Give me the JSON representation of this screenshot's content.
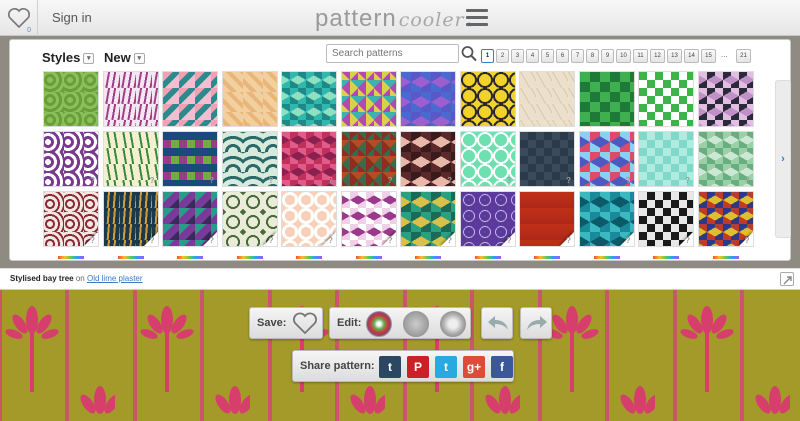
{
  "header": {
    "favorites_count": "0",
    "signin_label": "Sign in",
    "logo_text_a": "pattern",
    "logo_text_b": "cooler",
    "logo_star": "*"
  },
  "browser": {
    "styles_label": "Styles",
    "new_label": "New",
    "dropdown_glyph": "▾",
    "search_placeholder": "Search patterns",
    "pages": [
      "1",
      "2",
      "3",
      "4",
      "5",
      "6",
      "7",
      "8",
      "9",
      "10",
      "11",
      "12",
      "13",
      "14",
      "15"
    ],
    "active_page": "1",
    "pages_ellipsis": "...",
    "last_page": "21",
    "next_arrow": "›",
    "tile_unknown_mark": "?"
  },
  "selection": {
    "pattern_name": "Stylised bay tree",
    "on_label": "on",
    "background_name": "Old lime plaster"
  },
  "controls": {
    "save_label": "Save:",
    "edit_label": "Edit:",
    "share_label": "Share pattern:",
    "share_buttons": [
      {
        "label": "t",
        "color": "#2c4762",
        "icon": "tumblr-icon"
      },
      {
        "label": "P",
        "color": "#cb2027",
        "icon": "pinterest-icon"
      },
      {
        "label": "t",
        "color": "#2aa9e0",
        "icon": "twitter-icon"
      },
      {
        "label": "g+",
        "color": "#dd4b39",
        "icon": "google-plus-icon"
      },
      {
        "label": "f",
        "color": "#3b5998",
        "icon": "facebook-icon"
      }
    ]
  },
  "colors": {
    "accent": "#3a7ac8",
    "logo_star": "#36a3e0",
    "preview_ground": "#a49a2a",
    "preview_flower": "#d63f6b"
  }
}
